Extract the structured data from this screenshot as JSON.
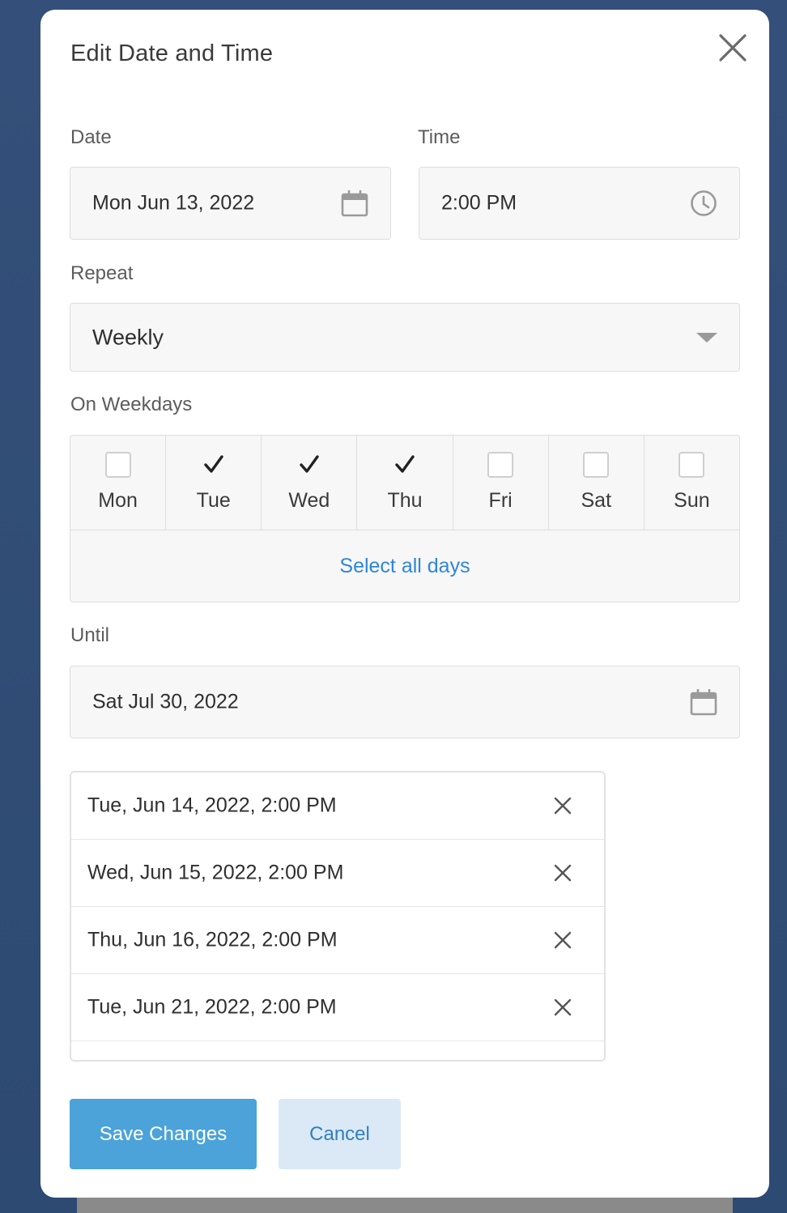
{
  "modal": {
    "title": "Edit Date and Time",
    "close_icon": "close-icon"
  },
  "date": {
    "label": "Date",
    "value": "Mon Jun 13, 2022",
    "icon": "calendar-icon"
  },
  "time": {
    "label": "Time",
    "value": "2:00 PM",
    "icon": "clock-icon"
  },
  "repeat": {
    "label": "Repeat",
    "value": "Weekly",
    "icon": "caret-down-icon"
  },
  "weekdays": {
    "label": "On Weekdays",
    "days": [
      {
        "label": "Mon",
        "checked": false
      },
      {
        "label": "Tue",
        "checked": true
      },
      {
        "label": "Wed",
        "checked": true
      },
      {
        "label": "Thu",
        "checked": true
      },
      {
        "label": "Fri",
        "checked": false
      },
      {
        "label": "Sat",
        "checked": false
      },
      {
        "label": "Sun",
        "checked": false
      }
    ],
    "select_all_label": "Select all days"
  },
  "until": {
    "label": "Until",
    "value": "Sat Jul 30, 2022",
    "icon": "calendar-icon"
  },
  "occurrences": [
    "Tue, Jun 14, 2022, 2:00 PM",
    "Wed, Jun 15, 2022, 2:00 PM",
    "Thu, Jun 16, 2022, 2:00 PM",
    "Tue, Jun 21, 2022, 2:00 PM"
  ],
  "actions": {
    "save_label": "Save Changes",
    "cancel_label": "Cancel"
  },
  "colors": {
    "accent": "#4ba3d9",
    "link": "#2f86d6",
    "cancel_bg": "#dbe9f6",
    "backdrop": "#34507a"
  }
}
